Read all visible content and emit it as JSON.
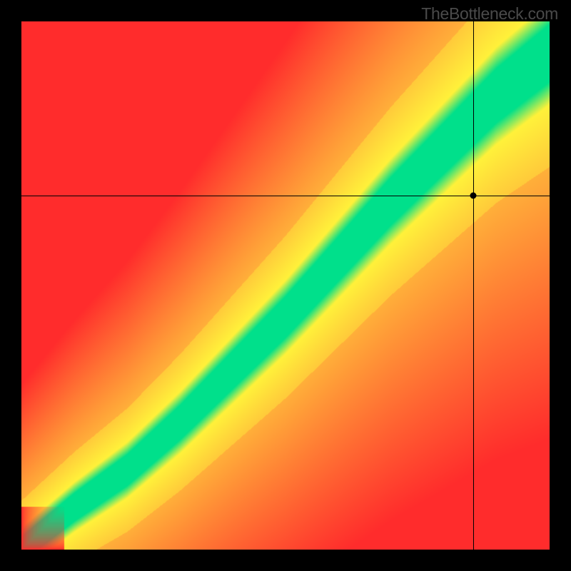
{
  "watermark": "TheBottleneck.com",
  "chart_data": {
    "type": "heatmap",
    "title": "",
    "xlabel": "",
    "ylabel": "",
    "xlim": [
      0,
      100
    ],
    "ylim": [
      0,
      100
    ],
    "grid": false,
    "legend": "none",
    "colorscale": {
      "optimal": "#00e08b",
      "near": "#fff23a",
      "warm": "#ffb03a",
      "poor": "#ff2c2c"
    },
    "ideal_curve_points": {
      "x": [
        0,
        10,
        20,
        30,
        40,
        50,
        60,
        70,
        80,
        90,
        100
      ],
      "y": [
        0,
        8,
        15,
        24,
        34,
        44,
        55,
        66,
        76,
        86,
        94
      ]
    },
    "band_half_width_pct": 7,
    "crosshair": {
      "x": 85.5,
      "y": 67
    },
    "marker": {
      "x": 85.5,
      "y": 67
    }
  }
}
